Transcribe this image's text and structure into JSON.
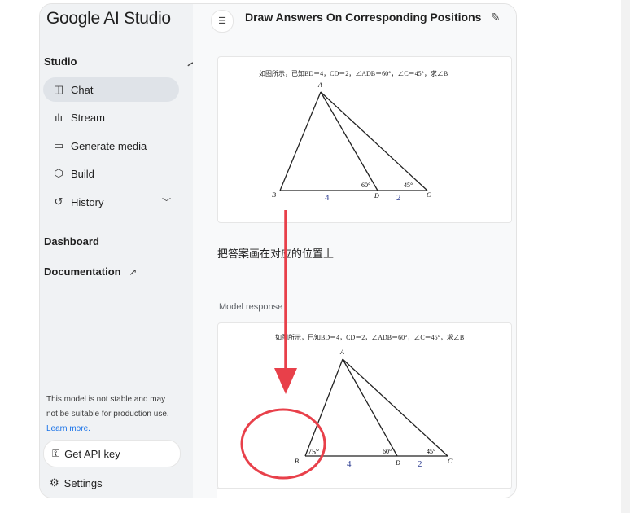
{
  "app": {
    "logo": "Google AI Studio"
  },
  "sidebar": {
    "studio_label": "Studio",
    "items": [
      {
        "label": "Chat",
        "icon": "chat-icon"
      },
      {
        "label": "Stream",
        "icon": "waveform-icon"
      },
      {
        "label": "Generate media",
        "icon": "image-icon"
      },
      {
        "label": "Build",
        "icon": "build-icon"
      },
      {
        "label": "History",
        "icon": "history-icon"
      }
    ],
    "dashboard_label": "Dashboard",
    "documentation_label": "Documentation",
    "note": "This model is not stable and may not be suitable for production use.",
    "learn_more": "Learn more.",
    "api_key_label": "Get API key",
    "settings_label": "Settings"
  },
  "main": {
    "title": "Draw Answers On Corresponding Positions",
    "prompt_text": "把答案画在对应的位置上",
    "response_label": "Model response",
    "problem_text": "如图所示，已知BD＝4，CD＝2，∠ADB＝60°，∠C＝45°，求∠B",
    "figure_labels": {
      "A": "A",
      "B": "B",
      "C": "C",
      "D": "D",
      "bd": "4",
      "dc": "2",
      "angle_d": "60°",
      "angle_c": "45°"
    },
    "answer_label": "75°"
  },
  "colors": {
    "accent": "#1a73e8",
    "annotation": "#e8404a",
    "ink": "#1f1f1f"
  }
}
